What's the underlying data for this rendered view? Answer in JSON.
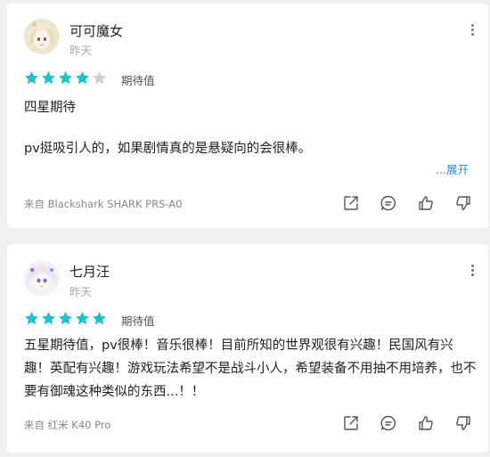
{
  "reviews": [
    {
      "username": "可可魔女",
      "date": "昨天",
      "rating": 4,
      "rating_max": 5,
      "rating_label": "期待值",
      "lines": [
        "四星期待",
        "pv挺吸引人的，如果剧情真的是悬疑向的会很棒。"
      ],
      "expand_label": "...展开",
      "device": "来自 Blackshark SHARK PRS-A0",
      "actions": [
        "share-icon",
        "comment-icon",
        "like-icon",
        "dislike-icon"
      ]
    },
    {
      "username": "七月汪",
      "date": "昨天",
      "rating": 5,
      "rating_max": 5,
      "rating_label": "期待值",
      "lines": [
        "五星期待值，pv很棒！音乐很棒！目前所知的世界观很有兴趣！民国风有兴趣！英配有兴趣！游戏玩法希望不是战斗小人，希望装备不用抽不用培养，也不要有御魂这种类似的东西...！！"
      ],
      "device": "来自 红米 K40 Pro",
      "actions": [
        "share-icon",
        "comment-icon",
        "like-icon",
        "dislike-icon"
      ]
    }
  ],
  "colors": {
    "star_filled": "#1dc3c8",
    "star_empty": "#d0d0d0",
    "link": "#2e8fd8",
    "background": "#f0f0f0"
  }
}
